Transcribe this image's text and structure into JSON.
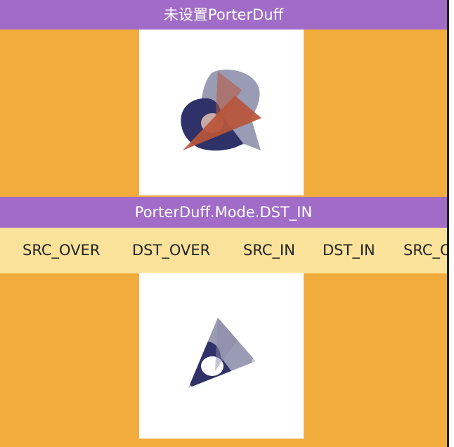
{
  "top_title": "未设置PorterDuff",
  "mode_title": "PorterDuff.Mode.DST_IN",
  "modes": [
    "SRC_OVER",
    "DST_OVER",
    "SRC_IN",
    "DST_IN",
    "SRC_OUT"
  ],
  "colors": {
    "background": "#F2AC3C",
    "title_bar": "#A06CC8",
    "mode_strip": "#FBE29A",
    "canvas": "#FFFFFF",
    "shape_dark_navy": "#2F3268",
    "shape_gray_blue": "#9A9BB4",
    "shape_orange": "#B8553A"
  }
}
